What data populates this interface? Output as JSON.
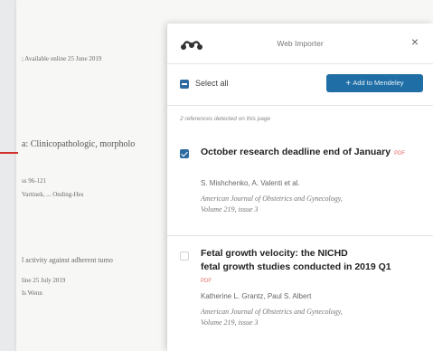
{
  "background_page": {
    "line1": "; Available online 25 June 2019",
    "line2": "a: Clinicopathologic, morpholo",
    "line3": "ss 96-121",
    "line4": "Vartinek, ... Onding-Hes",
    "line5": "l activity against adherent tumo",
    "line6": "line 25 July 2019",
    "line7": "Is Wenn"
  },
  "importer": {
    "title": "Web Importer",
    "close_glyph": "×",
    "select_all_label": "Select all",
    "add_button_label": "Add to Mendeley",
    "references_detected": "2 references detected on this page",
    "items": [
      {
        "title": "October research deadline end of January",
        "pdf": "PDF",
        "authors": "S. Mishchenko, A. Valenti et al.",
        "journal_line1": "American Journal of Obstetrics and Gynecology,",
        "journal_line2": "Volume 219, issue 3",
        "checked": true
      },
      {
        "title_line1": "Fetal growth velocity: the NICHD",
        "title_line2": "fetal growth studies conducted in 2019 Q1",
        "pdf": "PDF",
        "authors": "Katherine L. Grantz, Paul S. Albert",
        "journal_line1": "American Journal of Obstetrics and Gynecology,",
        "journal_line2": "Volume 219, issue 3",
        "checked": false
      }
    ]
  },
  "colors": {
    "accent": "#1f6ea6",
    "checkbox": "#2d6aa0",
    "pdf_badge": "#e36a6a"
  },
  "icons": {
    "logo": "mendeley-logo-icon",
    "close": "close-icon",
    "add": "plus-icon"
  }
}
